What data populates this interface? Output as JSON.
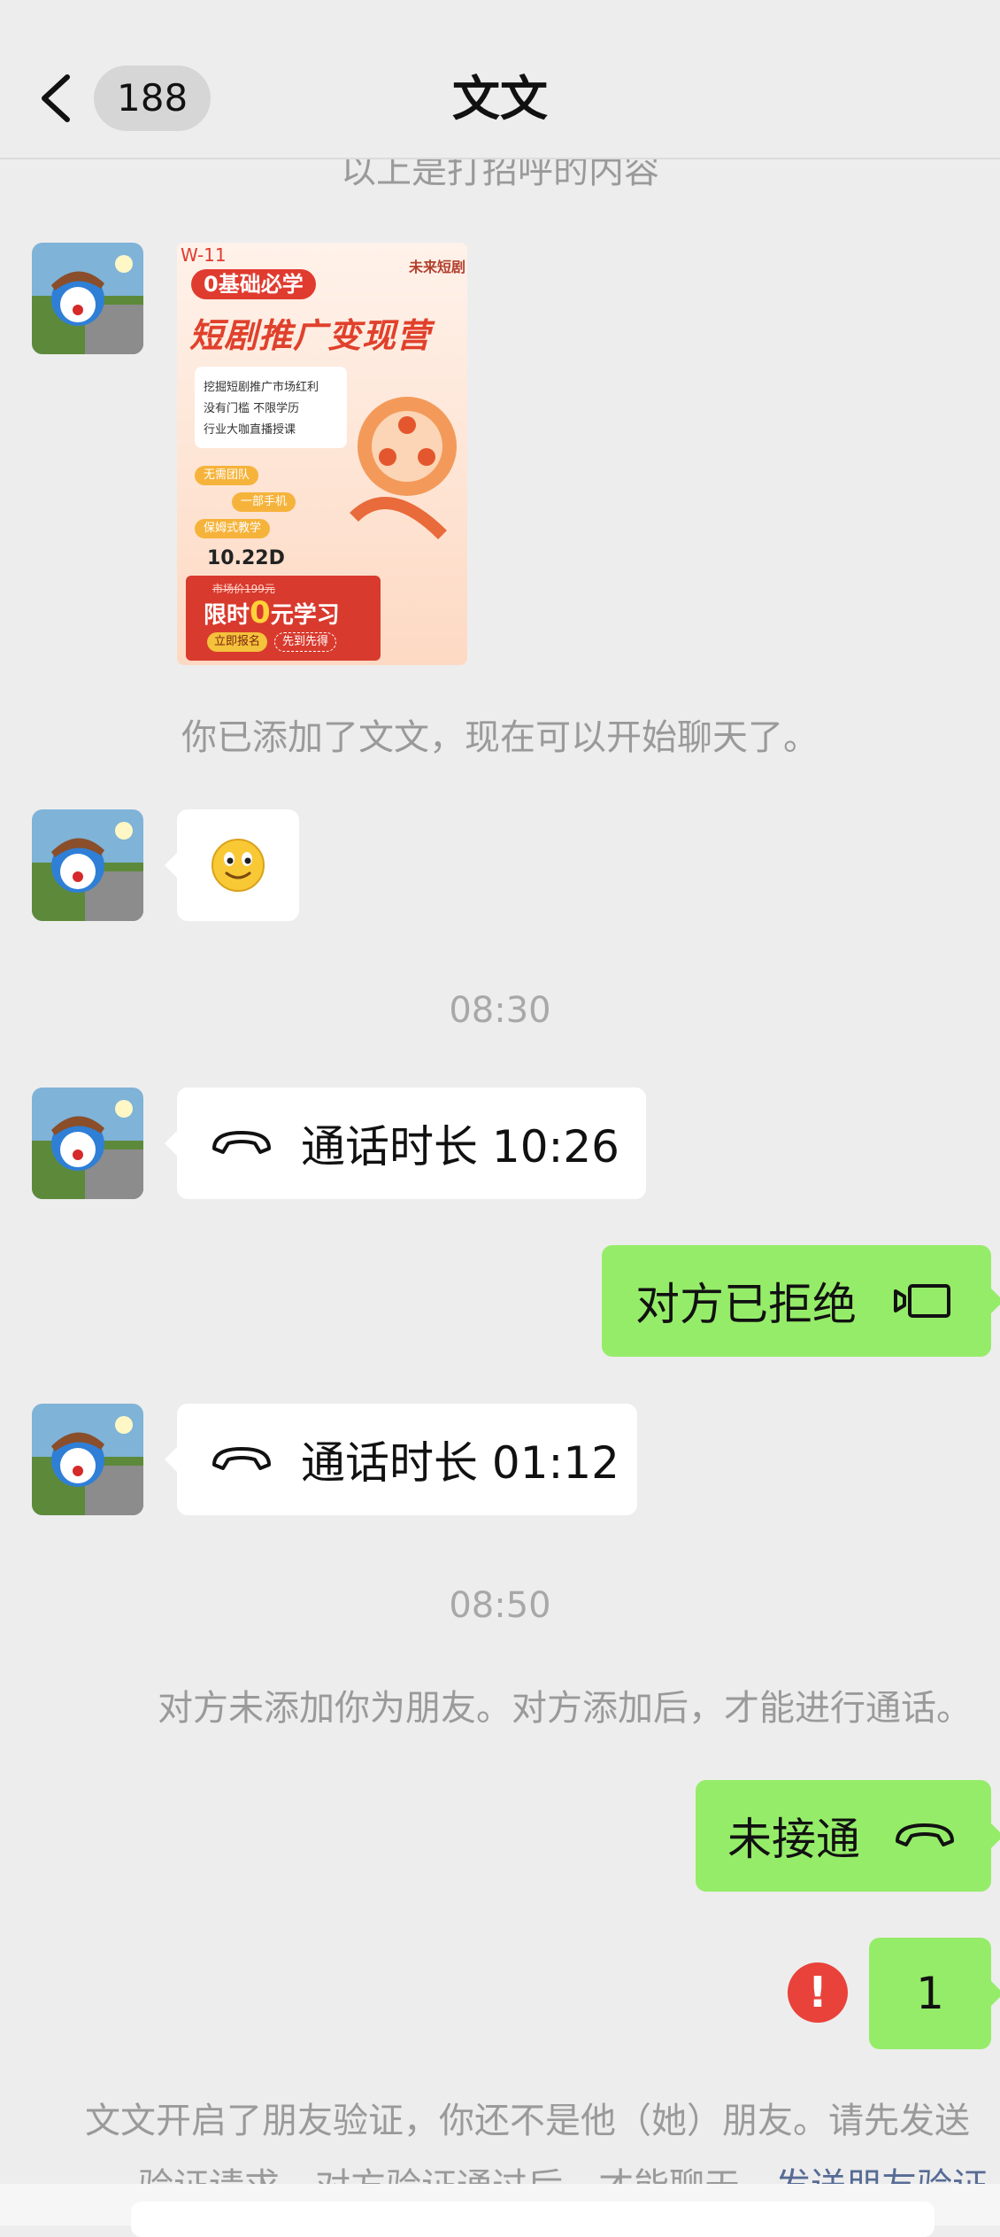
{
  "header": {
    "back_count": "188",
    "title": "文文"
  },
  "messages": {
    "top_clipped": "以上是打招呼的内容",
    "added_notice": "你已添加了文文，现在可以开始聊天了。",
    "time1": "08:30",
    "call1_label": "通话时长 10:26",
    "rejected_label": "对方已拒绝",
    "call2_label": "通话时长 01:12",
    "time2": "08:50",
    "not_friend_notice": "对方未添加你为朋友。对方添加后，才能进行通话。",
    "missed_label": "未接通",
    "text_one": "1",
    "verify_line1": "文文开启了朋友验证，你还不是他（她）朋友。请先发送",
    "verify_line2": "验证请求，对方验证通过后，才能聊天。",
    "verify_link": "发送朋友验证"
  },
  "poster": {
    "code": "W-11",
    "tag": "0基础必学",
    "brand": "未来短剧",
    "headline": "短剧推广变现营",
    "bullets": [
      "挖掘短剧推广市场红利",
      "没有门槛 不限学历",
      "行业大咖直播授课"
    ],
    "pills": [
      "无需团队",
      "一部手机",
      "保姆式教学"
    ],
    "date": "10.22D",
    "price_line": "市场价199元",
    "offer_prefix": "限时",
    "offer_zero": "0",
    "offer_suffix": "元学习",
    "cta1": "立即报名",
    "cta2": "先到先得"
  },
  "colors": {
    "background": "#ededed",
    "bubble_out": "#95ec69",
    "bubble_in": "#ffffff",
    "error": "#e9423b",
    "link": "#576b95"
  },
  "icons": [
    "back-chevron-icon",
    "phone-hangup-icon",
    "video-camera-icon",
    "error-icon",
    "emoji-smile-icon"
  ]
}
